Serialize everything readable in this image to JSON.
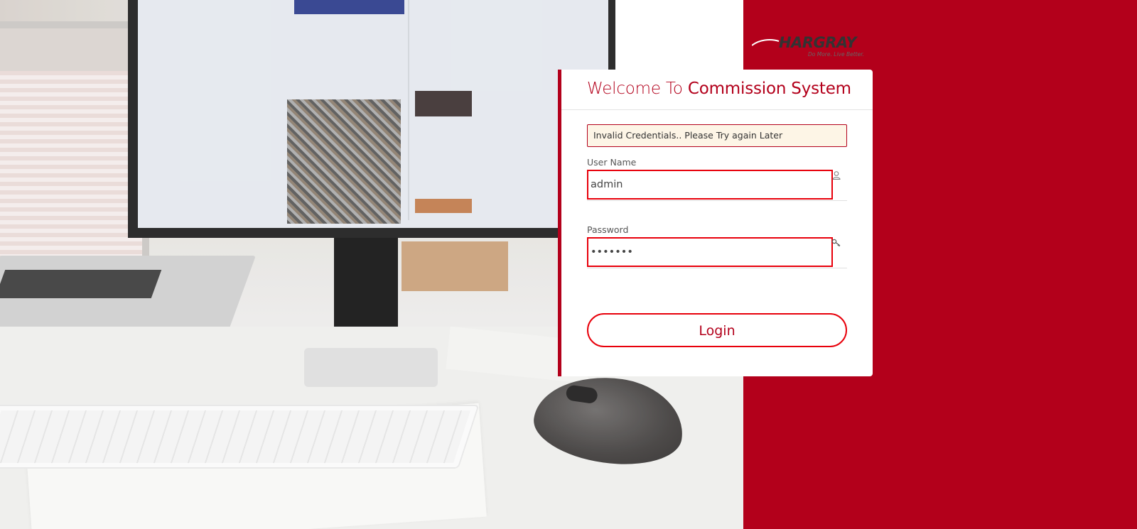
{
  "brand": {
    "name": "HARGRAY",
    "tagline": "Do More. Live Better.",
    "color_primary": "#b3001b",
    "color_input_border": "#e8000b"
  },
  "login": {
    "title_prefix": "Welcome To",
    "title_main": "Commission System",
    "alert_message": "Invalid Credentials.. Please Try again Later",
    "username": {
      "label": "User Name",
      "value": "admin",
      "icon": "user-icon"
    },
    "password": {
      "label": "Password",
      "value": "admin12",
      "icon": "key-icon"
    },
    "submit_label": "Login"
  }
}
